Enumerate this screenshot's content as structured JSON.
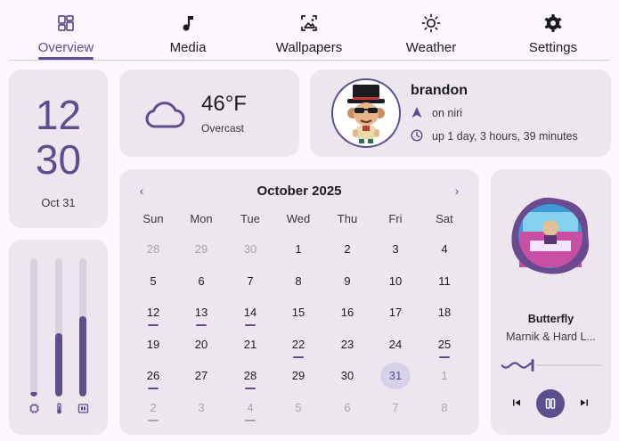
{
  "tabs": [
    {
      "label": "Overview",
      "icon": "dashboard-icon",
      "active": true
    },
    {
      "label": "Media",
      "icon": "music-note-icon",
      "active": false
    },
    {
      "label": "Wallpapers",
      "icon": "wallpaper-icon",
      "active": false
    },
    {
      "label": "Weather",
      "icon": "sun-icon",
      "active": false
    },
    {
      "label": "Settings",
      "icon": "gear-icon",
      "active": false
    }
  ],
  "clock": {
    "hours": "12",
    "minutes": "30",
    "date": "Oct 31"
  },
  "weather": {
    "temperature": "46°F",
    "condition": "Overcast",
    "icon": "cloud-icon"
  },
  "user": {
    "name": "brandon",
    "wm": "on niri",
    "uptime": "up 1 day, 3 hours, 39 minutes"
  },
  "resources": [
    {
      "name": "cpu",
      "icon": "cpu-icon",
      "level": 0.03
    },
    {
      "name": "temperature",
      "icon": "thermometer-icon",
      "level": 0.46
    },
    {
      "name": "memory",
      "icon": "memory-icon",
      "level": 0.58
    }
  ],
  "calendar": {
    "title": "October 2025",
    "weekdays": [
      "Sun",
      "Mon",
      "Tue",
      "Wed",
      "Thu",
      "Fri",
      "Sat"
    ],
    "weeks": [
      [
        {
          "d": "28",
          "muted": true
        },
        {
          "d": "29",
          "muted": true
        },
        {
          "d": "30",
          "muted": true
        },
        {
          "d": "1"
        },
        {
          "d": "2"
        },
        {
          "d": "3"
        },
        {
          "d": "4"
        }
      ],
      [
        {
          "d": "5"
        },
        {
          "d": "6"
        },
        {
          "d": "7"
        },
        {
          "d": "8"
        },
        {
          "d": "9"
        },
        {
          "d": "10"
        },
        {
          "d": "11"
        }
      ],
      [
        {
          "d": "12",
          "event": true
        },
        {
          "d": "13",
          "event": true
        },
        {
          "d": "14",
          "event": true
        },
        {
          "d": "15"
        },
        {
          "d": "16"
        },
        {
          "d": "17"
        },
        {
          "d": "18"
        }
      ],
      [
        {
          "d": "19"
        },
        {
          "d": "20"
        },
        {
          "d": "21"
        },
        {
          "d": "22",
          "event": true
        },
        {
          "d": "23"
        },
        {
          "d": "24"
        },
        {
          "d": "25",
          "event": true
        }
      ],
      [
        {
          "d": "26",
          "event": true
        },
        {
          "d": "27"
        },
        {
          "d": "28",
          "event": true
        },
        {
          "d": "29"
        },
        {
          "d": "30"
        },
        {
          "d": "31",
          "today": true
        },
        {
          "d": "1",
          "muted": true
        }
      ],
      [
        {
          "d": "2",
          "muted": true,
          "event": true
        },
        {
          "d": "3",
          "muted": true
        },
        {
          "d": "4",
          "muted": true,
          "event": true
        },
        {
          "d": "5",
          "muted": true
        },
        {
          "d": "6",
          "muted": true
        },
        {
          "d": "7",
          "muted": true
        },
        {
          "d": "8",
          "muted": true
        }
      ]
    ]
  },
  "media": {
    "title": "Butterfly",
    "artist": "Marnik & Hard L...",
    "progress": 0.31
  },
  "colors": {
    "accent": "#5b4f8f",
    "surface": "#ece6ef",
    "background": "#fdf8fd",
    "muted": "#a8a3ad"
  }
}
